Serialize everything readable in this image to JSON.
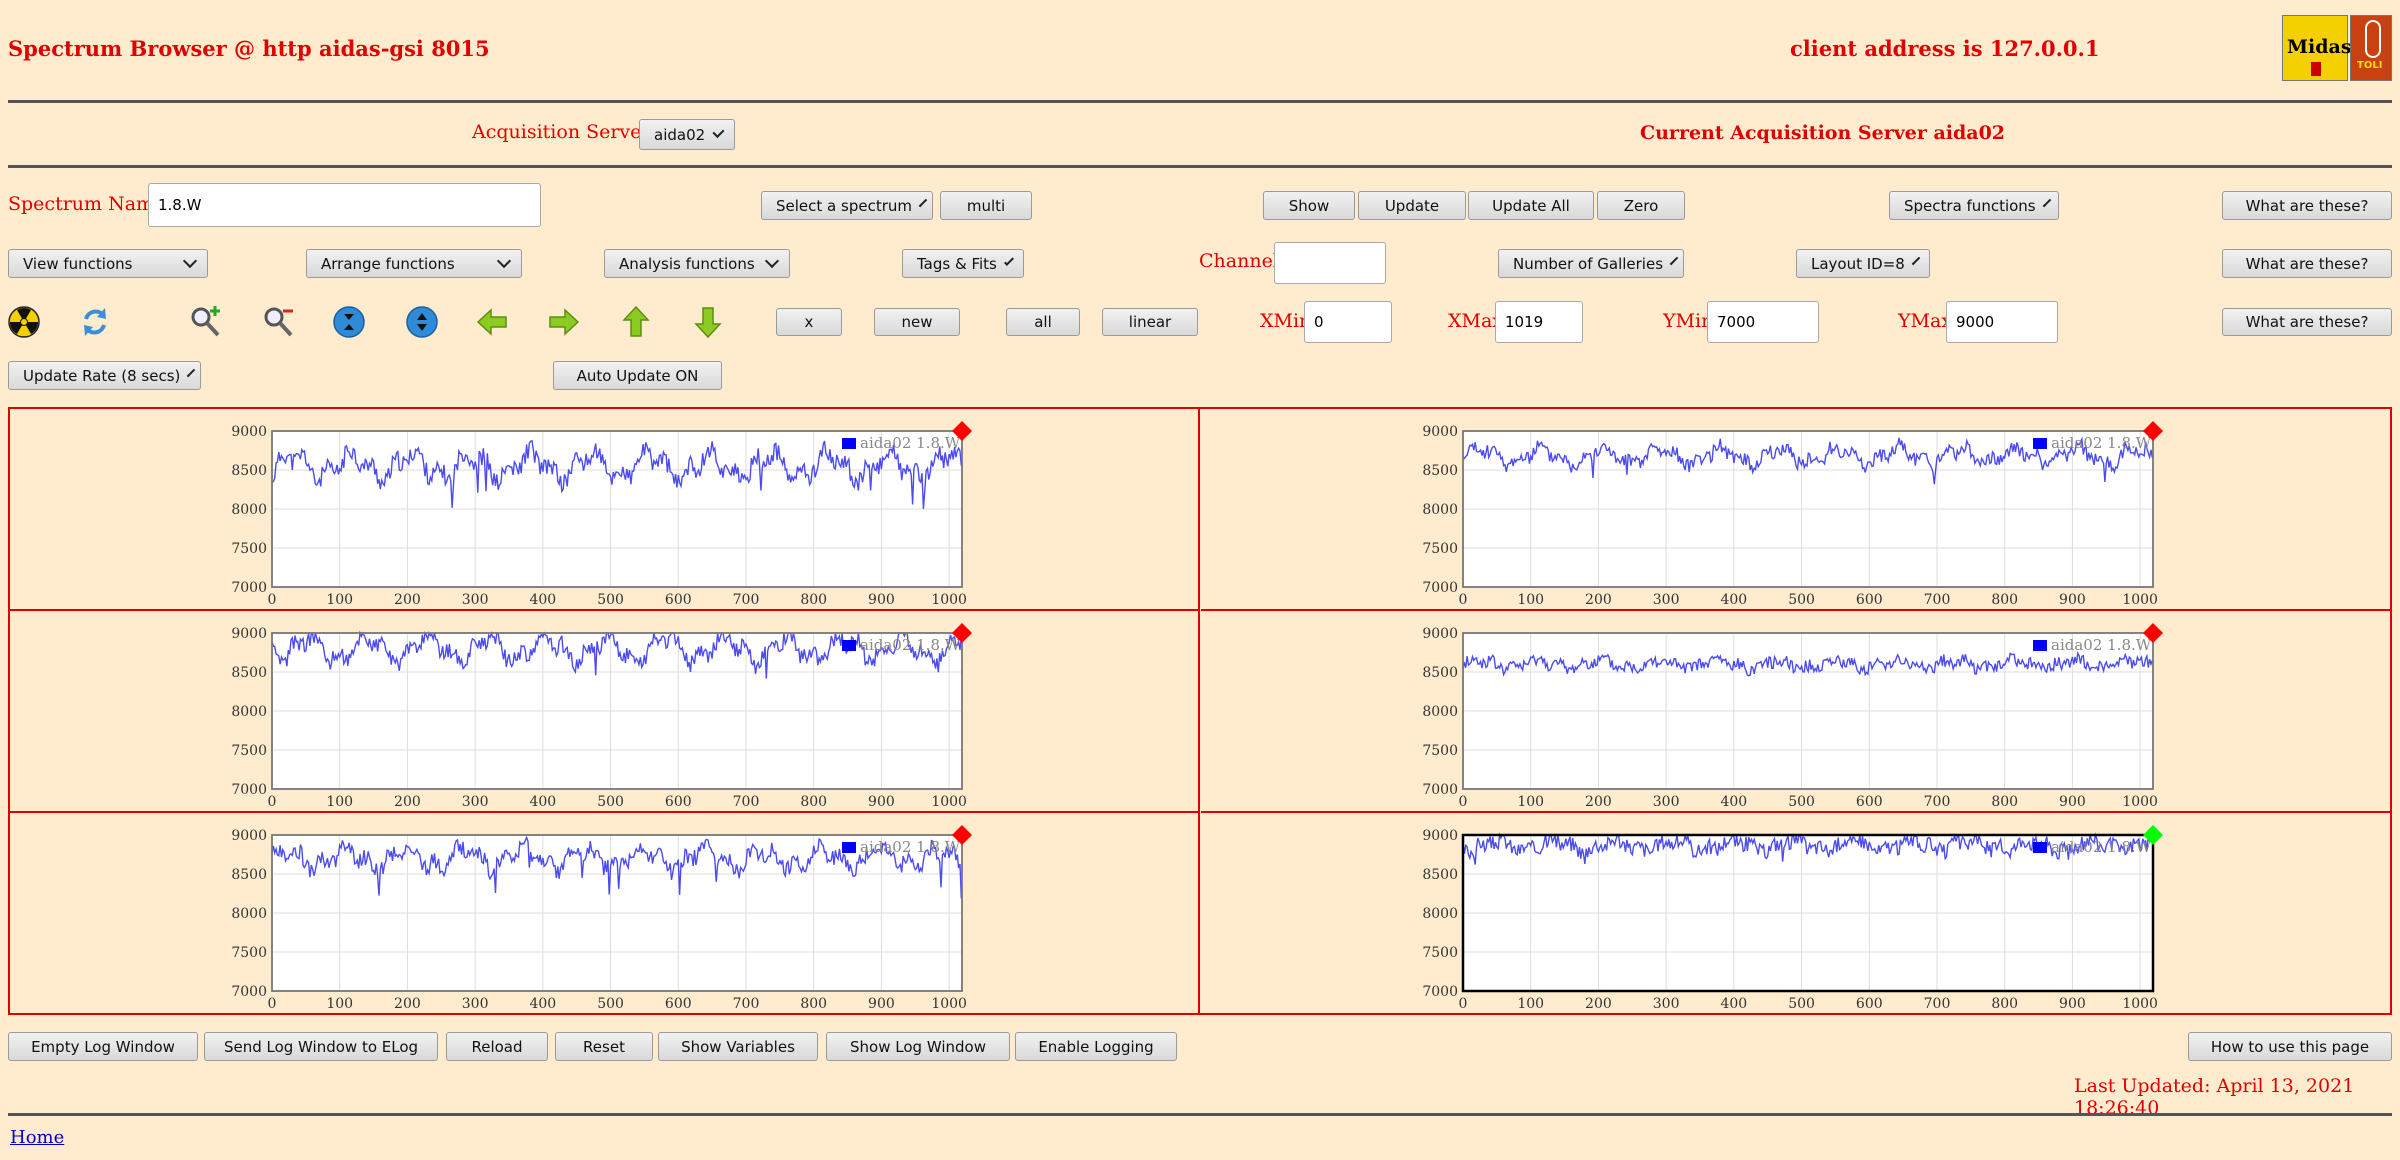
{
  "header": {
    "title": "Spectrum Browser @ http aidas-gsi 8015",
    "client_address": "client address is 127.0.0.1",
    "logo_text": "Midas",
    "logo2_text": "TOLI"
  },
  "acquisition": {
    "label": "Acquisition Servers",
    "selected": "aida02",
    "current": "Current Acquisition Server aida02"
  },
  "row1": {
    "spectrum_name_label": "Spectrum Name:",
    "spectrum_name_value": "1.8.W",
    "select_spectrum": "Select a spectrum",
    "multi": "multi",
    "show": "Show",
    "update": "Update",
    "update_all": "Update All",
    "zero": "Zero",
    "spectra_functions": "Spectra functions",
    "what": "What are these?"
  },
  "row2": {
    "view_functions": "View functions",
    "arrange_functions": "Arrange functions",
    "analysis_functions": "Analysis functions",
    "tags_fits": "Tags & Fits",
    "channel_label": "Channel:",
    "channel_value": "",
    "galleries": "Number of Galleries",
    "layout": "Layout ID=8",
    "what": "What are these?"
  },
  "row3": {
    "icons": [
      "radiation-icon",
      "refresh-icon",
      "zoom-in-icon",
      "zoom-out-icon",
      "expand-vertical-icon",
      "shrink-vertical-icon",
      "arrow-left-icon",
      "arrow-right-icon",
      "arrow-up-icon",
      "arrow-down-icon"
    ],
    "x": "x",
    "new": "new",
    "all": "all",
    "linear": "linear",
    "xmin_label": "XMin",
    "xmin_value": "0",
    "xmax_label": "XMax",
    "xmax_value": "1019",
    "ymin_label": "YMin",
    "ymin_value": "7000",
    "ymax_label": "YMax",
    "ymax_value": "9000",
    "what": "What are these?"
  },
  "row4": {
    "update_rate": "Update Rate (8 secs)",
    "auto_update": "Auto Update ON"
  },
  "chart_data": [
    {
      "type": "line",
      "legend": "aida02 1.8.W",
      "marker_color": "#ff0000",
      "x_range": [
        0,
        1019
      ],
      "ylim": [
        7000,
        9000
      ],
      "x_ticks": [
        "0",
        "100",
        "200",
        "300",
        "400",
        "500",
        "600",
        "700",
        "800",
        "900",
        "1000"
      ],
      "y_ticks": [
        "9000",
        "8500",
        "8000",
        "7500",
        "7000"
      ],
      "series": [
        {
          "name": "aida02 1.8.W",
          "baseline": 8550,
          "amplitude": 180,
          "noise": 120,
          "seed": 11
        }
      ]
    },
    {
      "type": "line",
      "legend": "aida02 1.8.W",
      "marker_color": "#ff0000",
      "x_range": [
        0,
        1019
      ],
      "ylim": [
        7000,
        9000
      ],
      "x_ticks": [
        "0",
        "100",
        "200",
        "300",
        "400",
        "500",
        "600",
        "700",
        "800",
        "900",
        "1000"
      ],
      "y_ticks": [
        "9000",
        "8500",
        "8000",
        "7500",
        "7000"
      ],
      "series": [
        {
          "name": "aida02 1.8.W",
          "baseline": 8680,
          "amplitude": 110,
          "noise": 90,
          "seed": 23
        }
      ]
    },
    {
      "type": "line",
      "legend": "aida02 1.8.W",
      "marker_color": "#ff0000",
      "x_range": [
        0,
        1019
      ],
      "ylim": [
        7000,
        9000
      ],
      "x_ticks": [
        "0",
        "100",
        "200",
        "300",
        "400",
        "500",
        "600",
        "700",
        "800",
        "900",
        "1000"
      ],
      "y_ticks": [
        "9000",
        "8500",
        "8000",
        "7500",
        "7000"
      ],
      "series": [
        {
          "name": "aida02 1.8.W",
          "baseline": 8800,
          "amplitude": 170,
          "noise": 110,
          "seed": 37
        }
      ]
    },
    {
      "type": "line",
      "legend": "aida02 1.8.W",
      "marker_color": "#ff0000",
      "x_range": [
        0,
        1019
      ],
      "ylim": [
        7000,
        9000
      ],
      "x_ticks": [
        "0",
        "100",
        "200",
        "300",
        "400",
        "500",
        "600",
        "700",
        "800",
        "900",
        "1000"
      ],
      "y_ticks": [
        "9000",
        "8500",
        "8000",
        "7500",
        "7000"
      ],
      "series": [
        {
          "name": "aida02 1.8.W",
          "baseline": 8600,
          "amplitude": 60,
          "noise": 80,
          "seed": 41
        }
      ]
    },
    {
      "type": "line",
      "legend": "aida02 1.8.W",
      "marker_color": "#ff0000",
      "x_range": [
        0,
        1019
      ],
      "ylim": [
        7000,
        9000
      ],
      "x_ticks": [
        "0",
        "100",
        "200",
        "300",
        "400",
        "500",
        "600",
        "700",
        "800",
        "900",
        "1000"
      ],
      "y_ticks": [
        "9000",
        "8500",
        "8000",
        "7500",
        "7000"
      ],
      "series": [
        {
          "name": "aida02 1.8.W",
          "baseline": 8700,
          "amplitude": 130,
          "noise": 110,
          "seed": 53
        }
      ]
    },
    {
      "type": "line",
      "legend": "aida02 1.8.W",
      "marker_color": "#00ff00",
      "x_range": [
        0,
        1019
      ],
      "ylim": [
        7000,
        9000
      ],
      "x_ticks": [
        "0",
        "100",
        "200",
        "300",
        "400",
        "500",
        "600",
        "700",
        "800",
        "900",
        "1000"
      ],
      "y_ticks": [
        "9000",
        "8500",
        "8000",
        "7500",
        "7000"
      ],
      "series": [
        {
          "name": "aida02 1.8.W",
          "baseline": 8870,
          "amplitude": 70,
          "noise": 100,
          "seed": 67
        }
      ]
    }
  ],
  "bottom": {
    "empty_log": "Empty Log Window",
    "send_log": "Send Log Window to ELog",
    "reload": "Reload",
    "reset": "Reset",
    "show_vars": "Show Variables",
    "show_log": "Show Log Window",
    "enable_logging": "Enable Logging",
    "how_to": "How to use this page",
    "last_updated": "Last Updated: April 13, 2021 18:26:40",
    "home": "Home"
  },
  "colors": {
    "accent_red": "#e00000",
    "trace": "#4b4bf0",
    "background": "#ffebcd"
  }
}
